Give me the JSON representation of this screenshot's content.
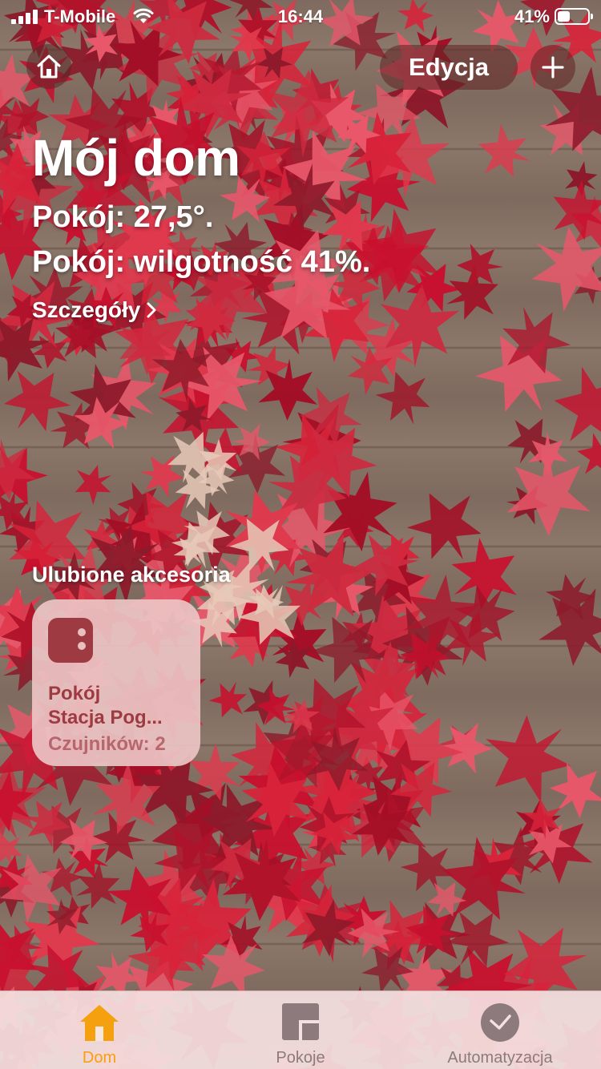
{
  "status_bar": {
    "carrier": "T-Mobile",
    "time": "16:44",
    "battery_percent": "41%",
    "battery_level": 0.41,
    "icons": [
      "signal-icon",
      "wifi-icon",
      "battery-icon"
    ]
  },
  "nav": {
    "home_icon": "home-icon",
    "edit_label": "Edycja",
    "add_icon": "plus-icon"
  },
  "header": {
    "title": "Mój dom",
    "temperature_line": "Pokój: 27,5°.",
    "humidity_line": "Pokój: wilgotność 41%.",
    "details_link": "Szczegóły"
  },
  "favorites": {
    "section_title": "Ulubione akcesoria",
    "tiles": [
      {
        "icon": "sensor-icon",
        "room": "Pokój",
        "name": "Stacja Pog...",
        "status": "Czujników: 2"
      }
    ]
  },
  "tabbar": {
    "tabs": [
      {
        "label": "Dom",
        "icon": "house-tab-icon",
        "active": true
      },
      {
        "label": "Pokoje",
        "icon": "rooms-tab-icon",
        "active": false
      },
      {
        "label": "Automatyzacja",
        "icon": "checkmark-circle-icon",
        "active": false
      }
    ]
  },
  "colors": {
    "accent": "#F5A00F",
    "tile_background": "#ECC4C4",
    "tile_text": "#9E3B42",
    "tab_inactive": "#8D7A7C"
  }
}
